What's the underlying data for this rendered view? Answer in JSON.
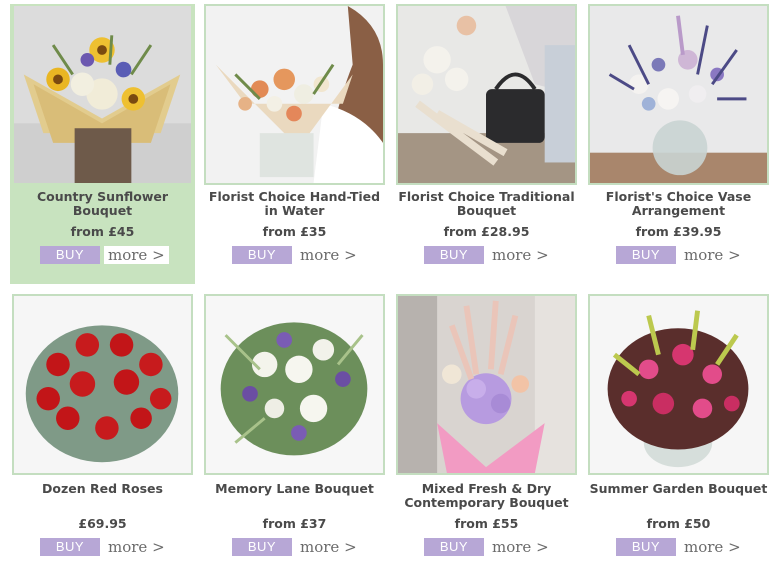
{
  "products": [
    {
      "title": "Country Sunflower Bouquet",
      "price": "from £45",
      "buy_label": "BUY",
      "more_label": "more >",
      "image": "sunflower-bouquet-image"
    },
    {
      "title": "Florist Choice Hand-Tied in Water",
      "price": "from £35",
      "buy_label": "BUY",
      "more_label": "more >",
      "image": "hand-tied-bouquet-image"
    },
    {
      "title": "Florist Choice Traditional Bouquet",
      "price": "from £28.95",
      "buy_label": "BUY",
      "more_label": "more >",
      "image": "traditional-bouquet-image"
    },
    {
      "title": "Florist's Choice Vase Arrangement",
      "price": "from £39.95",
      "buy_label": "BUY",
      "more_label": "more >",
      "image": "vase-arrangement-image"
    },
    {
      "title": "Dozen Red Roses",
      "price": "£69.95",
      "buy_label": "BUY",
      "more_label": "more >",
      "image": "red-roses-image"
    },
    {
      "title": "Memory Lane Bouquet",
      "price": "from £37",
      "buy_label": "BUY",
      "more_label": "more >",
      "image": "memory-lane-bouquet-image"
    },
    {
      "title": "Mixed Fresh & Dry Contemporary Bouquet",
      "price": "from £55",
      "buy_label": "BUY",
      "more_label": "more >",
      "image": "fresh-dry-bouquet-image"
    },
    {
      "title": "Summer Garden Bouquet",
      "price": "from £50",
      "buy_label": "BUY",
      "more_label": "more >",
      "image": "summer-garden-bouquet-image"
    }
  ],
  "colors": {
    "highlight": "#c8e3bf",
    "buy_button": "#b7a7d6",
    "photo_border": "#c4dec0"
  }
}
